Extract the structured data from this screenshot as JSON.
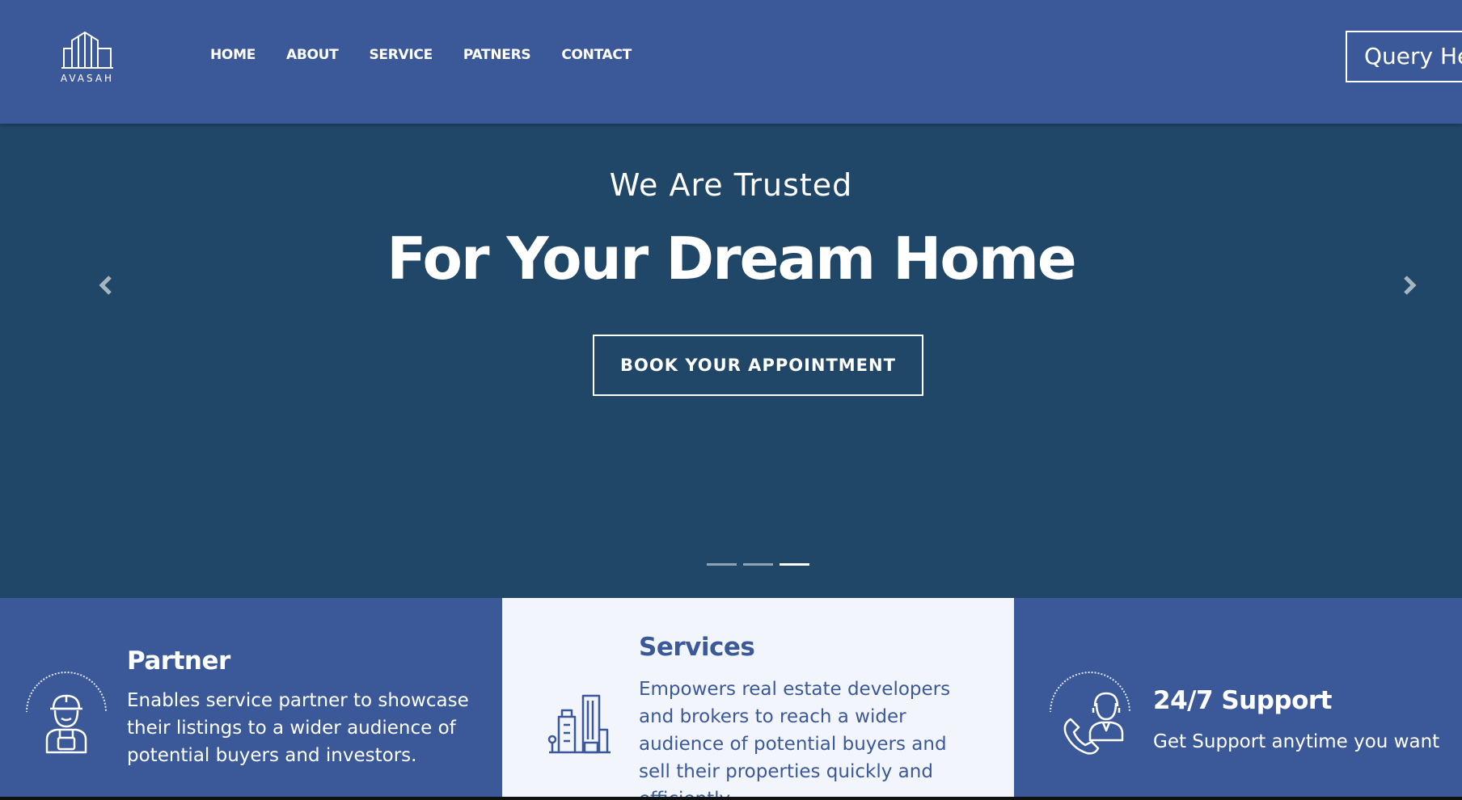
{
  "brand": {
    "name": "AVASAH"
  },
  "nav": {
    "items": [
      "HOME",
      "ABOUT",
      "SERVICE",
      "PATNERS",
      "CONTACT"
    ],
    "query_button": "Query Here"
  },
  "hero": {
    "subtitle": "We Are Trusted",
    "title": "For Your Dream Home",
    "cta": "BOOK YOUR APPOINTMENT",
    "slides_total": 3,
    "active_slide": 3
  },
  "features": [
    {
      "title": "Partner",
      "text": "Enables service partner to showcase their listings to a wider audience of potential buyers and investors.",
      "icon": "worker-icon"
    },
    {
      "title": "Services",
      "text": "Empowers real estate developers and brokers to reach a wider audience of potential buyers and sell their properties quickly and efficiently.",
      "icon": "buildings-icon"
    },
    {
      "title": "24/7 Support",
      "text": "Get Support anytime you want",
      "icon": "support-agent-icon"
    }
  ],
  "colors": {
    "navbar": "#3b5998",
    "hero": "#204668",
    "card_light": "#f3f5fc",
    "accent_text": "#3b5998"
  }
}
